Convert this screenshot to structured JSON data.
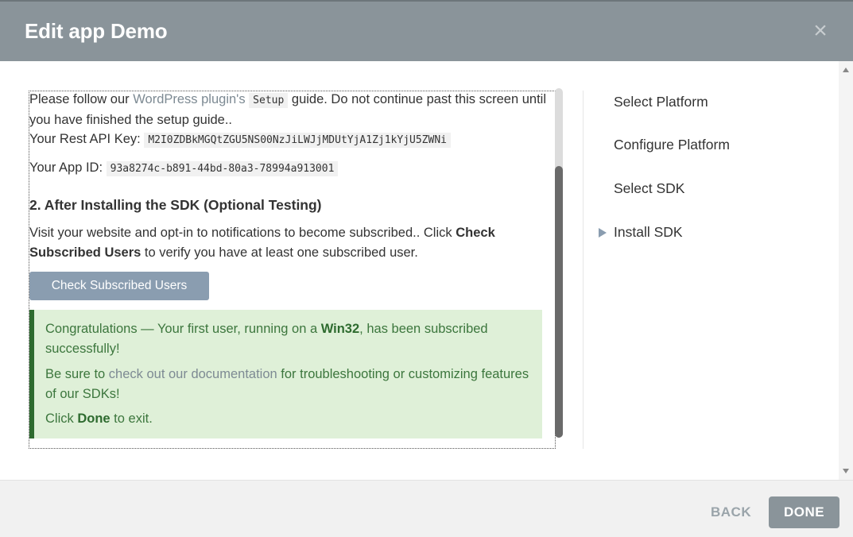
{
  "header": {
    "title": "Edit app Demo",
    "close_icon": "×"
  },
  "content": {
    "intro_before_link": "Please follow our ",
    "intro_link": "WordPress plugin's",
    "intro_code": "Setup",
    "intro_after": " guide. Do not continue past this screen until you have finished the setup guide..",
    "rest_api_key_label": "Your Rest API Key:",
    "rest_api_key_value": "M2I0ZDBkMGQtZGU5NS00NzJiLWJjMDUtYjA1Zj1kYjU5ZWNi",
    "app_id_label": "Your App ID:",
    "app_id_value": "93a8274c-b891-44bd-80a3-78994a913001",
    "section_heading": "2. After Installing the SDK (Optional Testing)",
    "visit_text_1": "Visit your website and opt-in to notifications to become subscribed.. Click ",
    "visit_bold": "Check Subscribed Users",
    "visit_text_2": " to verify you have at least one subscribed user.",
    "check_button": "Check Subscribed Users"
  },
  "success": {
    "line1_a": "Congratulations — Your first user, running on a ",
    "line1_bold": "Win32",
    "line1_b": ", has been subscribed successfully!",
    "line2_a": "Be sure to ",
    "line2_link": "check out our documentation",
    "line2_b": " for troubleshooting or customizing features of our SDKs!",
    "line3_a": "Click ",
    "line3_bold": "Done",
    "line3_b": " to exit."
  },
  "steps": [
    {
      "label": "Select Platform"
    },
    {
      "label": "Configure Platform"
    },
    {
      "label": "Select SDK"
    },
    {
      "label": "Install SDK"
    }
  ],
  "footer": {
    "back_label": "BACK",
    "done_label": "DONE"
  }
}
